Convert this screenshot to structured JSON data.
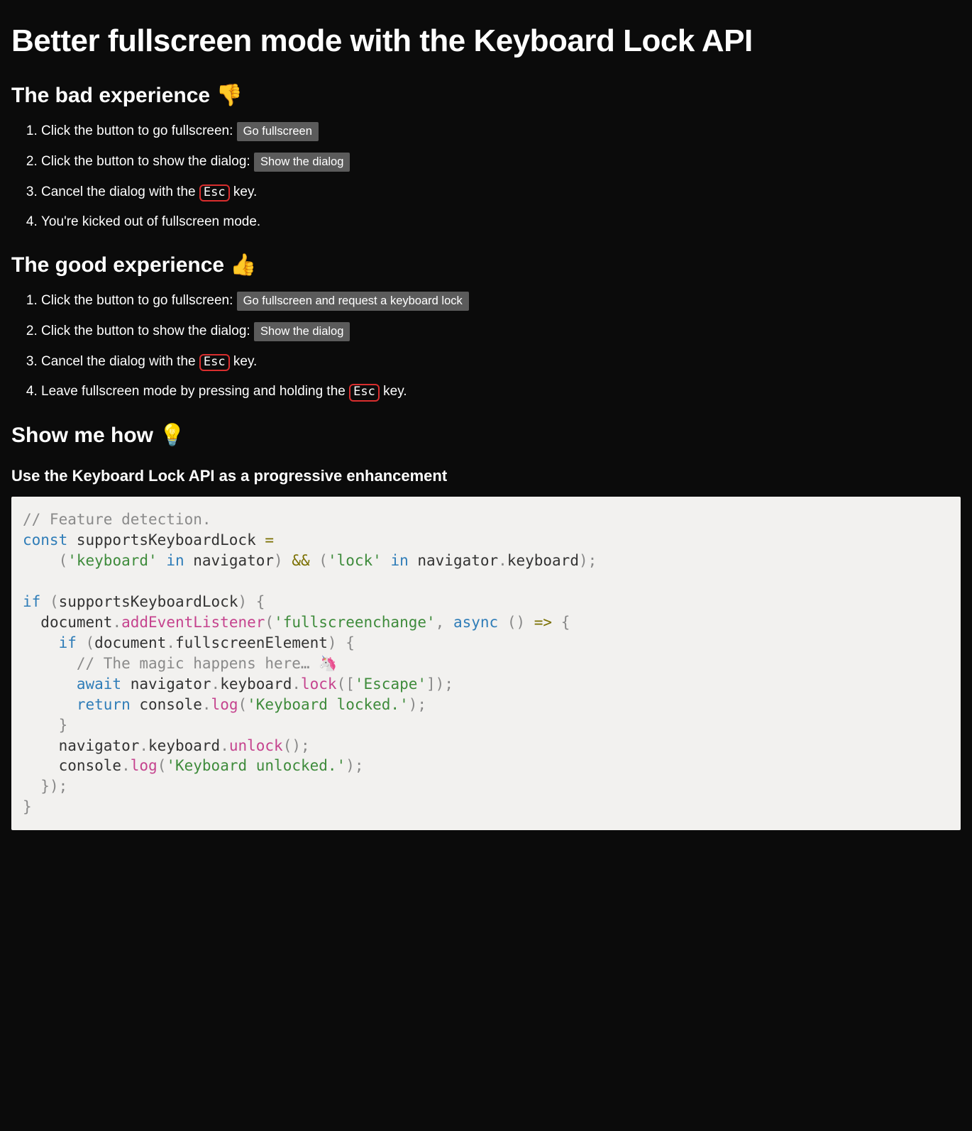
{
  "title": "Better fullscreen mode with the Keyboard Lock API",
  "bad": {
    "heading": "The bad experience 👎",
    "step1_text": "Click the button to go fullscreen: ",
    "step1_button": "Go fullscreen",
    "step2_text": "Click the button to show the dialog: ",
    "step2_button": "Show the dialog",
    "step3_pre": "Cancel the dialog with the ",
    "step3_kbd": "Esc",
    "step3_post": " key.",
    "step4": "You're kicked out of fullscreen mode."
  },
  "good": {
    "heading": "The good experience 👍",
    "step1_text": "Click the button to go fullscreen: ",
    "step1_button": "Go fullscreen and request a keyboard lock",
    "step2_text": "Click the button to show the dialog: ",
    "step2_button": "Show the dialog",
    "step3_pre": "Cancel the dialog with the ",
    "step3_kbd": "Esc",
    "step3_post": " key.",
    "step4_pre": "Leave fullscreen mode by pressing and holding the ",
    "step4_kbd": "Esc",
    "step4_post": " key."
  },
  "how": {
    "heading": "Show me how 💡",
    "subheading": "Use the Keyboard Lock API as a progressive enhancement"
  },
  "code": {
    "c1": "// Feature detection.",
    "l2_const": "const",
    "l2_name": " supportsKeyboardLock ",
    "l2_eq": "=",
    "l3_indent": "    ",
    "l3_p1": "(",
    "l3_s1": "'keyboard'",
    "l3_in": " in ",
    "l3_nav": "navigator",
    "l3_p2": ")",
    "l3_and": " && ",
    "l3_p3": "(",
    "l3_s2": "'lock'",
    "l3_nav2": "navigator",
    "l3_dot": ".",
    "l3_kb": "keyboard",
    "l3_p4": ")",
    "l3_semi": ";",
    "l5_if": "if",
    "l5_sp": " ",
    "l5_p1": "(",
    "l5_cond": "supportsKeyboardLock",
    "l5_p2": ")",
    "l5_brace": " {",
    "l6_indent": "  ",
    "l6_doc": "document",
    "l6_dot": ".",
    "l6_fn": "addEventListener",
    "l6_p1": "(",
    "l6_s1": "'fullscreenchange'",
    "l6_comma": ",",
    "l6_async": " async ",
    "l6_p2": "()",
    "l6_arrow": " => ",
    "l6_brace": "{",
    "l7_indent": "    ",
    "l7_if": "if",
    "l7_p1": " (",
    "l7_doc": "document",
    "l7_dot": ".",
    "l7_fse": "fullscreenElement",
    "l7_p2": ")",
    "l7_brace": " {",
    "l8_indent": "      ",
    "l8_comment": "// The magic happens here… 🦄",
    "l9_indent": "      ",
    "l9_await": "await",
    "l9_sp": " ",
    "l9_nav": "navigator",
    "l9_dot1": ".",
    "l9_kb": "keyboard",
    "l9_dot2": ".",
    "l9_lock": "lock",
    "l9_p1": "([",
    "l9_s1": "'Escape'",
    "l9_p2": "]);",
    "l10_indent": "      ",
    "l10_return": "return",
    "l10_sp": " ",
    "l10_console": "console",
    "l10_dot": ".",
    "l10_log": "log",
    "l10_p1": "(",
    "l10_s1": "'Keyboard locked.'",
    "l10_p2": ");",
    "l11_indent": "    ",
    "l11_brace": "}",
    "l12_indent": "    ",
    "l12_nav": "navigator",
    "l12_dot1": ".",
    "l12_kb": "keyboard",
    "l12_dot2": ".",
    "l12_unlock": "unlock",
    "l12_p": "();",
    "l13_indent": "    ",
    "l13_console": "console",
    "l13_dot": ".",
    "l13_log": "log",
    "l13_p1": "(",
    "l13_s1": "'Keyboard unlocked.'",
    "l13_p2": ");",
    "l14_indent": "  ",
    "l14_close": "});",
    "l15_brace": "}"
  }
}
